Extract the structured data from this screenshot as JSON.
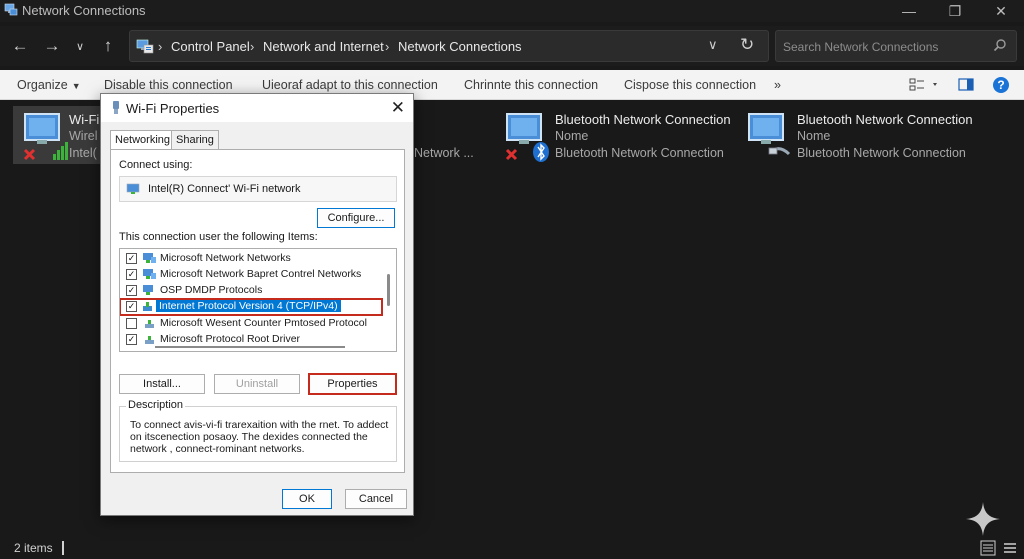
{
  "window": {
    "title": "Network Connections"
  },
  "address": {
    "crumbs": [
      "Control Panel",
      "Network and Internet",
      "Network Connections"
    ]
  },
  "search": {
    "placeholder": "Search Network Connections"
  },
  "toolbar": {
    "organize": "Organize",
    "disable": "Disable this connection",
    "diagnose": "Uieoraf adapt to this connection",
    "rename": "Chrinnte this connection",
    "dispose": "Cispose this connection",
    "more": "»"
  },
  "items": [
    {
      "name": "Wi-Fi",
      "line2": "Wirel",
      "line3": "Intel(",
      "status": "disconnected"
    },
    {
      "name": "Bluetooth Network Connection",
      "line2": "Nome",
      "line3": "Bluetooth Network Connection",
      "status": "disconnected"
    },
    {
      "name": "Bluetooth Network Connection",
      "line2": "Nome",
      "line3": "Bluetooth Network Connection",
      "status": "cable"
    }
  ],
  "partial_item": {
    "line3": "Network ..."
  },
  "status": {
    "count": "2 items"
  },
  "dialog": {
    "title": "Wi-Fi Properties",
    "tabs": [
      "Networking",
      "Sharing"
    ],
    "connect_using_label": "Connect using:",
    "adapter": "Intel(R) Connect' Wi-Fi network",
    "configure": "Configure...",
    "items_label": "This connection user the following Items:",
    "list": [
      {
        "label": "Microsoft Network Networks",
        "checked": "✓",
        "selected": false
      },
      {
        "label": "Microsoft Network Bapret Contrel Networks",
        "checked": "✓",
        "selected": false
      },
      {
        "label": "OSP DMDP Protocols",
        "checked": "✓",
        "selected": false
      },
      {
        "label": "Internet Protocol Version 4 (TCP/IPv4)",
        "checked": "✓",
        "selected": true
      },
      {
        "label": "Microsoft Wesent Counter Pmtosed Protocol",
        "checked": "",
        "selected": false
      },
      {
        "label": "Microsoft Protocol Root Driver",
        "checked": "✓",
        "selected": false
      }
    ],
    "install": "Install...",
    "uninstall": "Uninstall",
    "properties": "Properties",
    "description_label": "Description",
    "description": "To connect avis-vi-fi trarexaition with the rnet. To addect on itscenection posaoy. The dexides connected the network , connect-rominant networks.",
    "ok": "OK",
    "cancel": "Cancel"
  },
  "colors": {
    "accent": "#0078d4",
    "highlight_border": "#c42b1c",
    "background": "#191919"
  }
}
